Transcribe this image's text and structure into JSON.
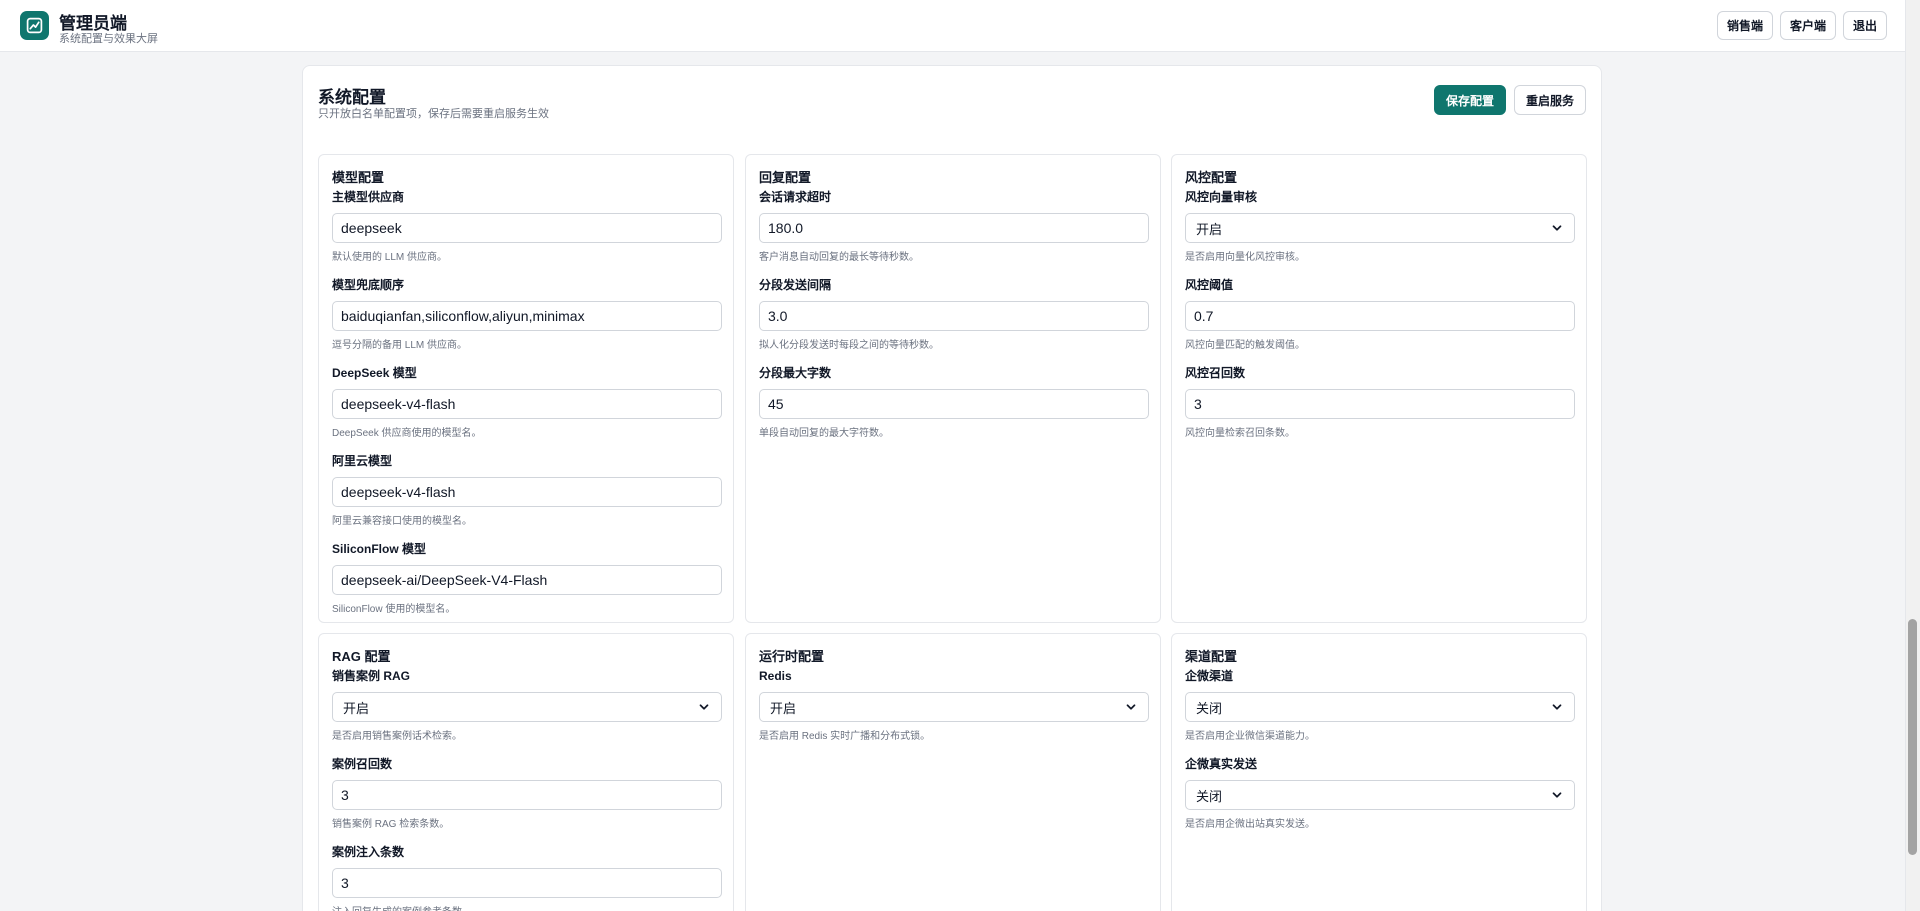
{
  "header": {
    "title": "管理员端",
    "subtitle": "系统配置与效果大屏",
    "actions": [
      "销售端",
      "客户端",
      "退出"
    ]
  },
  "panel": {
    "title": "系统配置",
    "subtitle": "只开放白名单配置项，保存后需要重启服务生效",
    "save_label": "保存配置",
    "restart_label": "重启服务"
  },
  "cards": [
    {
      "title": "模型配置",
      "fields": [
        {
          "label": "主模型供应商",
          "type": "input",
          "value": "deepseek",
          "help": "默认使用的 LLM 供应商。"
        },
        {
          "label": "模型兜底顺序",
          "type": "input",
          "value": "baiduqianfan,siliconflow,aliyun,minimax",
          "help": "逗号分隔的备用 LLM 供应商。"
        },
        {
          "label": "DeepSeek 模型",
          "type": "input",
          "value": "deepseek-v4-flash",
          "help": "DeepSeek 供应商使用的模型名。"
        },
        {
          "label": "阿里云模型",
          "type": "input",
          "value": "deepseek-v4-flash",
          "help": "阿里云兼容接口使用的模型名。"
        },
        {
          "label": "SiliconFlow 模型",
          "type": "input",
          "value": "deepseek-ai/DeepSeek-V4-Flash",
          "help": "SiliconFlow 使用的模型名。"
        }
      ]
    },
    {
      "title": "回复配置",
      "fields": [
        {
          "label": "会话请求超时",
          "type": "input",
          "value": "180.0",
          "help": "客户消息自动回复的最长等待秒数。"
        },
        {
          "label": "分段发送间隔",
          "type": "input",
          "value": "3.0",
          "help": "拟人化分段发送时每段之间的等待秒数。"
        },
        {
          "label": "分段最大字数",
          "type": "input",
          "value": "45",
          "help": "单段自动回复的最大字符数。"
        }
      ]
    },
    {
      "title": "风控配置",
      "fields": [
        {
          "label": "风控向量审核",
          "type": "select",
          "value": "开启",
          "help": "是否启用向量化风控审核。"
        },
        {
          "label": "风控阈值",
          "type": "input",
          "value": "0.7",
          "help": "风控向量匹配的触发阈值。"
        },
        {
          "label": "风控召回数",
          "type": "input",
          "value": "3",
          "help": "风控向量检索召回条数。"
        }
      ]
    },
    {
      "title": "RAG 配置",
      "fields": [
        {
          "label": "销售案例 RAG",
          "type": "select",
          "value": "开启",
          "help": "是否启用销售案例话术检索。"
        },
        {
          "label": "案例召回数",
          "type": "input",
          "value": "3",
          "help": "销售案例 RAG 检索条数。"
        },
        {
          "label": "案例注入条数",
          "type": "input",
          "value": "3",
          "help": "注入回复生成的案例参考条数。"
        }
      ]
    },
    {
      "title": "运行时配置",
      "fields": [
        {
          "label": "Redis",
          "type": "select",
          "value": "开启",
          "help": "是否启用 Redis 实时广播和分布式锁。"
        }
      ]
    },
    {
      "title": "渠道配置",
      "fields": [
        {
          "label": "企微渠道",
          "type": "select",
          "value": "关闭",
          "help": "是否启用企业微信渠道能力。"
        },
        {
          "label": "企微真实发送",
          "type": "select",
          "value": "关闭",
          "help": "是否启用企微出站真实发送。"
        }
      ]
    }
  ]
}
